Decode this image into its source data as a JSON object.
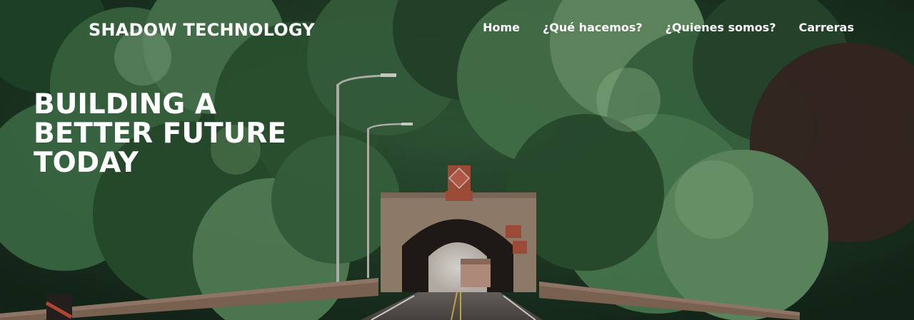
{
  "brand": {
    "name": "SHADOW TECHNOLOGY"
  },
  "nav": {
    "items": [
      {
        "label": "Home"
      },
      {
        "label": "¿Qué hacemos?"
      },
      {
        "label": "¿Quienes somos?"
      },
      {
        "label": "Carreras"
      }
    ]
  },
  "hero": {
    "headline_lines": [
      "BUILDING A",
      "BETTER FUTURE",
      "TODAY"
    ]
  },
  "colors": {
    "text": "#ffffff",
    "forest_dark": "#1e3a24",
    "forest_mid": "#3e6e45",
    "forest_light": "#6c9a6c",
    "tunnel_stone": "#a08a76",
    "bridge_rail": "#8a6f5c"
  }
}
